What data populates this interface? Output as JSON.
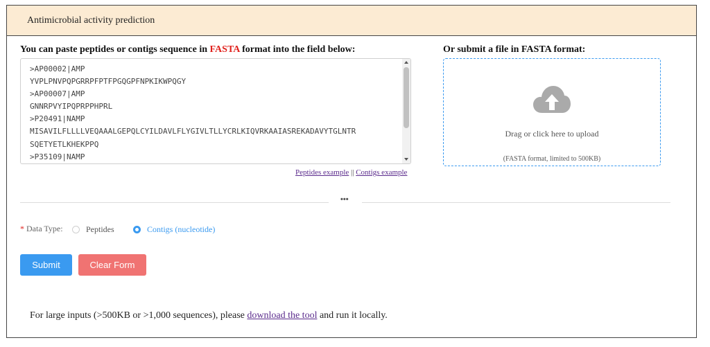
{
  "header": {
    "title": "Antimicrobial activity prediction"
  },
  "left": {
    "title_before": "You can paste peptides or contigs sequence in ",
    "title_highlight": "FASTA",
    "title_after": " format into the field below:",
    "sequence_value": ">AP00002|AMP\nYVPLPNVPQPGRRPFPTFPGQGPFNPKIKWPQGY\n>AP00007|AMP\nGNNRPVYIPQPRPPHPRL\n>P20491|NAMP\nMISAVILFLLLLVEQAAALGEPQLCYILDAVLFLYGIVLTLLYCRLKIQVRKAAIASREKADAVYTGLNTR\nSQETYETLKHEKPPQ\n>P35109|NAMP",
    "peptides_example_label": "Peptides example",
    "separator": "||",
    "contigs_example_label": "Contigs example"
  },
  "right": {
    "title": "Or submit a file in FASTA format:",
    "upload_text": "Drag or click here to upload",
    "upload_hint": "(FASTA format, limited to 500KB)",
    "upload_icon": "cloud-upload-icon"
  },
  "divider": {
    "label": "•••"
  },
  "data_type": {
    "required_mark": "*",
    "label": "Data Type:",
    "options": [
      {
        "label": "Peptides",
        "selected": false
      },
      {
        "label": "Contigs (nucleotide)",
        "selected": true
      }
    ]
  },
  "buttons": {
    "submit": "Submit",
    "clear": "Clear Form"
  },
  "footer": {
    "text_before": "For large inputs (>500KB or >1,000 sequences), please ",
    "link": "download the tool",
    "text_after": " and run it locally."
  },
  "colors": {
    "header_bg": "#fcebd3",
    "accent": "#3a9af0",
    "danger": "#f07372",
    "highlight": "#e0201b",
    "link": "#5a2a8c"
  }
}
